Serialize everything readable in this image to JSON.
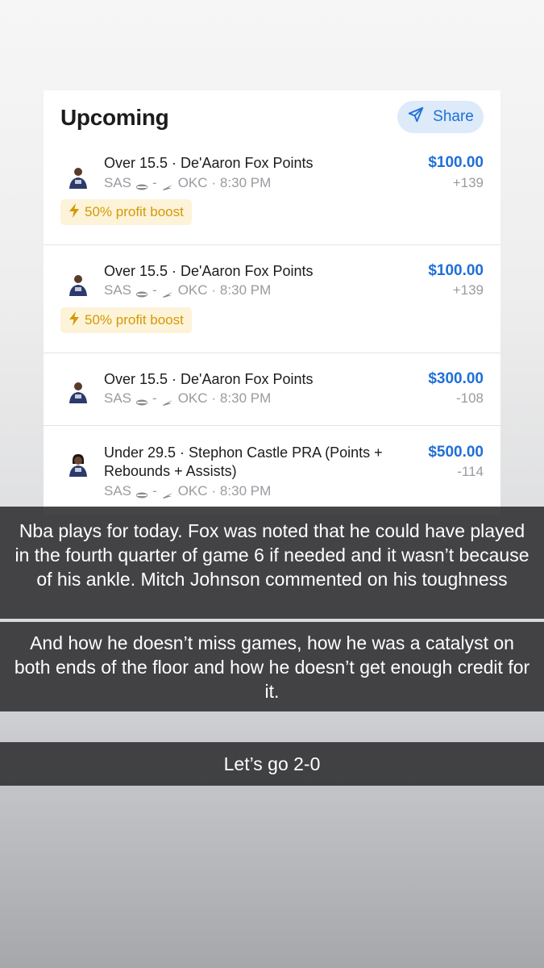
{
  "card": {
    "title": "Upcoming",
    "share_label": "Share",
    "bets": [
      {
        "line": "Over 15.5 · De'Aaron Fox Points",
        "away": "SAS",
        "home": "OKC",
        "sep": "-",
        "time": "· 8:30 PM",
        "amount": "$100.00",
        "odds": "+139",
        "boost": "50% profit boost"
      },
      {
        "line": "Over 15.5 · De'Aaron Fox Points",
        "away": "SAS",
        "home": "OKC",
        "sep": "-",
        "time": "· 8:30 PM",
        "amount": "$100.00",
        "odds": "+139",
        "boost": "50% profit boost"
      },
      {
        "line": "Over 15.5 · De'Aaron Fox Points",
        "away": "SAS",
        "home": "OKC",
        "sep": "-",
        "time": "· 8:30 PM",
        "amount": "$300.00",
        "odds": "-108"
      },
      {
        "line": "Under 29.5 · Stephon Castle PRA (Points + Rebounds + Assists)",
        "away": "SAS",
        "home": "OKC",
        "sep": "-",
        "time": "· 8:30 PM",
        "amount": "$500.00",
        "odds": "-114"
      }
    ]
  },
  "captions": [
    "Nba plays for today. Fox was noted that he could have played in the fourth quarter of game 6 if needed and it wasn’t because of his ankle. Mitch Johnson commented on his toughness",
    "And how he doesn’t miss games, how he was a catalyst on both ends of the floor and how he doesn’t get enough credit for it.",
    "Let’s go 2-0"
  ],
  "colors": {
    "accent": "#1f6fd8",
    "boost_text": "#d49a05",
    "boost_bg": "#fdf3d9",
    "share_bg": "#dceaf9",
    "caption_bg": "#323234"
  },
  "icons": {
    "share": "paper-plane-icon",
    "boost": "lightning-bolt-icon",
    "away_team": "spurs-logo-icon",
    "home_team": "thunder-logo-icon",
    "player": "player-headshot-icon"
  }
}
